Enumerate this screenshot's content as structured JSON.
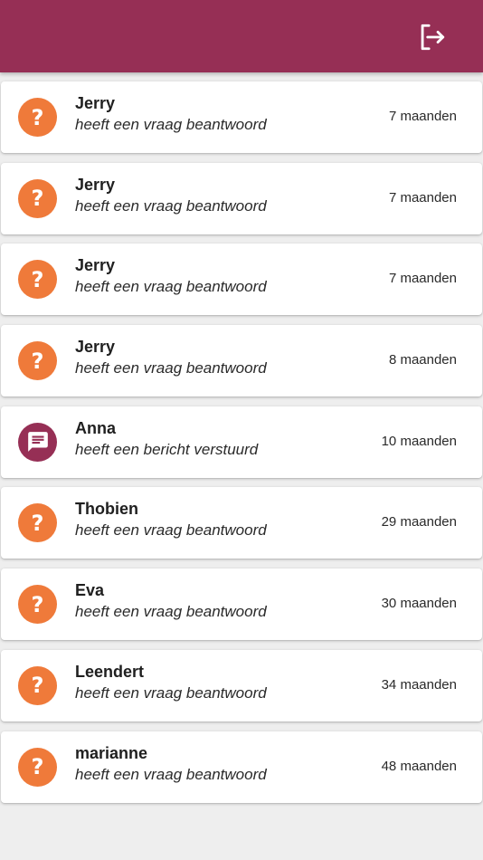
{
  "colors": {
    "app_bar": "#962f55",
    "question_avatar": "#ef7a3a",
    "message_avatar": "#962f55",
    "background": "#eeeeee"
  },
  "header": {
    "logout_icon": "logout-icon"
  },
  "notifications": [
    {
      "name": "Jerry",
      "action": "heeft een vraag beantwoord",
      "time": "7 maanden",
      "icon": "question-icon"
    },
    {
      "name": "Jerry",
      "action": "heeft een vraag beantwoord",
      "time": "7 maanden",
      "icon": "question-icon"
    },
    {
      "name": "Jerry",
      "action": "heeft een vraag beantwoord",
      "time": "7 maanden",
      "icon": "question-icon"
    },
    {
      "name": "Jerry",
      "action": "heeft een vraag beantwoord",
      "time": "8 maanden",
      "icon": "question-icon"
    },
    {
      "name": "Anna",
      "action": "heeft een bericht verstuurd",
      "time": "10 maanden",
      "icon": "message-icon"
    },
    {
      "name": "Thobien",
      "action": "heeft een vraag beantwoord",
      "time": "29 maanden",
      "icon": "question-icon"
    },
    {
      "name": "Eva",
      "action": "heeft een vraag beantwoord",
      "time": "30 maanden",
      "icon": "question-icon"
    },
    {
      "name": "Leendert",
      "action": "heeft een vraag beantwoord",
      "time": "34 maanden",
      "icon": "question-icon"
    },
    {
      "name": "marianne",
      "action": "heeft een vraag beantwoord",
      "time": "48 maanden",
      "icon": "question-icon"
    }
  ]
}
